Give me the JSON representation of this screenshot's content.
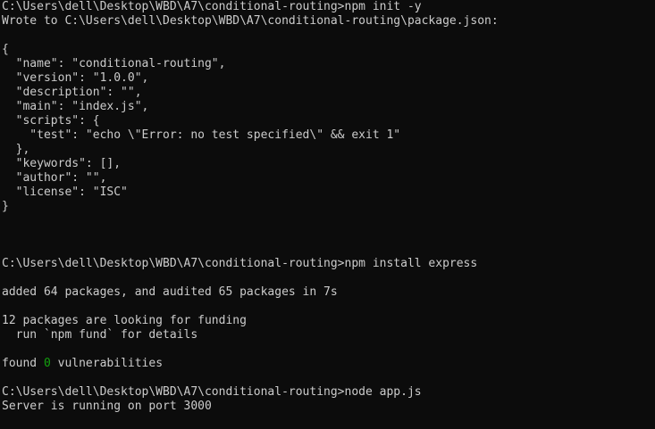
{
  "terminal": {
    "lines": [
      "C:\\Users\\dell\\Desktop\\WBD\\A7\\conditional-routing>npm init -y",
      "Wrote to C:\\Users\\dell\\Desktop\\WBD\\A7\\conditional-routing\\package.json:",
      "",
      "{",
      "  \"name\": \"conditional-routing\",",
      "  \"version\": \"1.0.0\",",
      "  \"description\": \"\",",
      "  \"main\": \"index.js\",",
      "  \"scripts\": {",
      "    \"test\": \"echo \\\"Error: no test specified\\\" && exit 1\"",
      "  },",
      "  \"keywords\": [],",
      "  \"author\": \"\",",
      "  \"license\": \"ISC\"",
      "}",
      "",
      "",
      "",
      "C:\\Users\\dell\\Desktop\\WBD\\A7\\conditional-routing>npm install express",
      "",
      "added 64 packages, and audited 65 packages in 7s",
      "",
      "12 packages are looking for funding",
      "  run `npm fund` for details",
      "",
      "",
      "",
      "C:\\Users\\dell\\Desktop\\WBD\\A7\\conditional-routing>node app.js",
      "Server is running on port 3000"
    ],
    "vulnerabilities": {
      "prefix": "found ",
      "count": "0",
      "suffix": " vulnerabilities"
    },
    "colors": {
      "background": "#0c0c0c",
      "text": "#cccccc",
      "highlight": "#13a10e"
    }
  }
}
